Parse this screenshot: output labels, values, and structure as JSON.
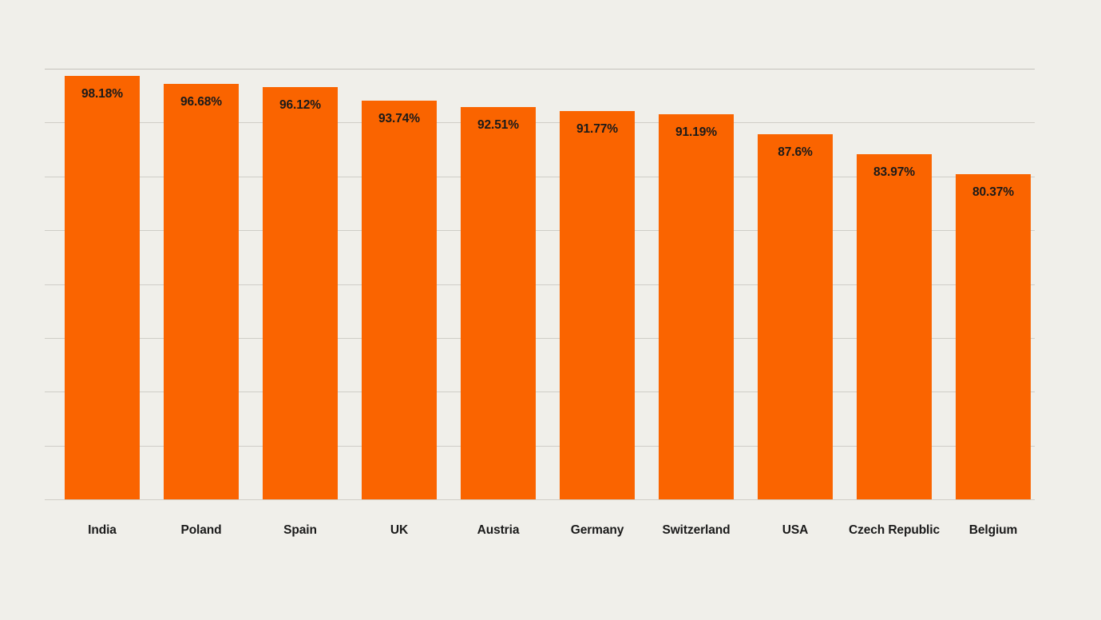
{
  "chart_data": {
    "type": "bar",
    "title": "",
    "subtitle": "",
    "xlabel": "",
    "ylabel": "",
    "categories": [
      "India",
      "Poland",
      "Spain",
      "UK",
      "Austria",
      "Germany",
      "Switzerland",
      "USA",
      "Czech Republic",
      "Belgium"
    ],
    "values": [
      98.18,
      96.68,
      96.12,
      93.74,
      92.51,
      91.77,
      91.19,
      87.6,
      83.97,
      80.37
    ],
    "value_labels": [
      "98.18%",
      "96.68%",
      "96.12%",
      "93.74%",
      "92.51%",
      "91.77%",
      "91.19%",
      "87.6%",
      "83.97%",
      "80.37%"
    ],
    "series": [
      {
        "name": "",
        "values": [
          98.18,
          96.68,
          96.12,
          93.74,
          92.51,
          91.77,
          91.19,
          87.6,
          83.97,
          80.37
        ]
      }
    ],
    "ylim": [
      21.3,
      99.5
    ],
    "grid": true,
    "gridlines_count": 9,
    "legend": "none",
    "tick_labels_y": [],
    "tick_labels_x": [
      "India",
      "Poland",
      "Spain",
      "UK",
      "Austria",
      "Germany",
      "Switzerland",
      "USA",
      "Czech Republic",
      "Belgium"
    ],
    "annotations": [],
    "orientation": "vertical",
    "sorted": "descending"
  },
  "style": {
    "background_color": "#F0EFEA",
    "bar_color": "#FA6400",
    "label_text_color": "#1A1A1A",
    "gridline_color": "#CFCDC7"
  }
}
